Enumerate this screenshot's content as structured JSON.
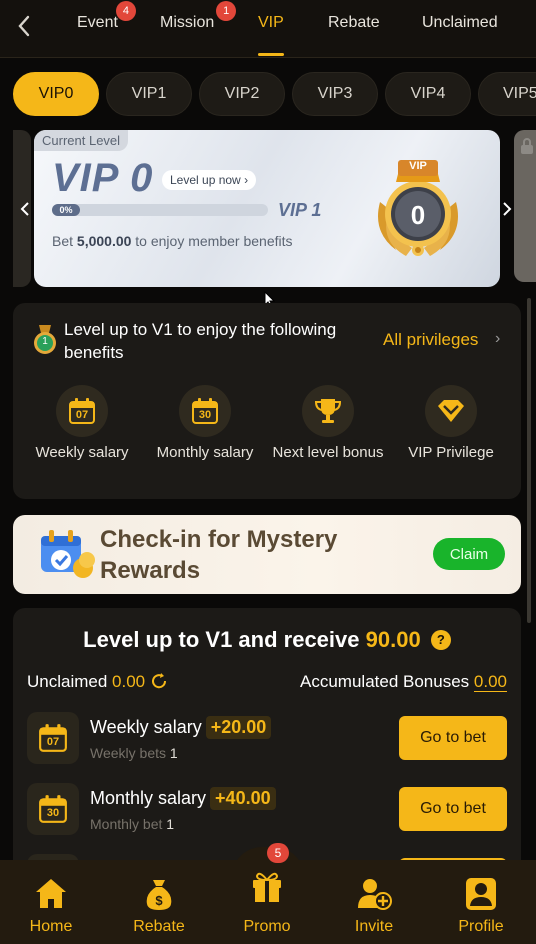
{
  "nav": {
    "tabs": [
      {
        "label": "Event",
        "badge": "4"
      },
      {
        "label": "Mission",
        "badge": "1"
      },
      {
        "label": "VIP",
        "badge": ""
      },
      {
        "label": "Rebate",
        "badge": ""
      },
      {
        "label": "Unclaimed",
        "badge": ""
      }
    ],
    "active_tab": "VIP"
  },
  "vip_pills": [
    "VIP0",
    "VIP1",
    "VIP2",
    "VIP3",
    "VIP4",
    "VIP5"
  ],
  "level_card": {
    "current_label": "Current Level",
    "vip_level": "VIP 0",
    "level_up_button": "Level up now",
    "progress_text": "0%",
    "progress_fraction": 0,
    "next_level": "VIP 1",
    "bet_prefix": "Bet",
    "bet_amount": "5,000.00",
    "bet_suffix": "to enjoy member benefits",
    "medal_number": "0",
    "medal_ribbon": "VIP"
  },
  "benefits": {
    "badge_number": "1",
    "heading": "Level up to V1 to enjoy the following benefits",
    "all_privileges": "All privileges",
    "items": [
      {
        "label": "Weekly salary",
        "icon": "calendar-icon",
        "icon_text": "07"
      },
      {
        "label": "Monthly salary",
        "icon": "calendar-icon",
        "icon_text": "30"
      },
      {
        "label": "Next level bonus",
        "icon": "trophy-icon",
        "icon_text": ""
      },
      {
        "label": "VIP Privilege",
        "icon": "diamond-icon",
        "icon_text": ""
      }
    ]
  },
  "checkin": {
    "text": "Check-in for Mystery Rewards",
    "claim": "Claim"
  },
  "levelup": {
    "title_prefix": "Level up to V1 and receive",
    "title_amount": "90.00",
    "help": "?",
    "unclaimed_label": "Unclaimed",
    "unclaimed_value": "0.00",
    "accumulated_label": "Accumulated Bonuses",
    "accumulated_value": "0.00",
    "tasks": [
      {
        "name": "Weekly salary",
        "bonus": "+20.00",
        "sub_label": "Weekly bets",
        "sub_value": "1",
        "button": "Go to bet",
        "icon_text": "07"
      },
      {
        "name": "Monthly salary",
        "bonus": "+40.00",
        "sub_label": "Monthly bet",
        "sub_value": "1",
        "button": "Go to bet",
        "icon_text": "30"
      }
    ]
  },
  "bottom_nav": {
    "items": [
      {
        "label": "Home",
        "icon": "home-icon"
      },
      {
        "label": "Rebate",
        "icon": "money-bag-icon"
      },
      {
        "label": "Promo",
        "icon": "gift-icon"
      },
      {
        "label": "Invite",
        "icon": "add-user-icon"
      },
      {
        "label": "Profile",
        "icon": "profile-icon"
      }
    ],
    "promo_badge": "5"
  },
  "colors": {
    "accent": "#f5b718",
    "background": "#0a0908",
    "panel": "#1c1a17",
    "claim_green": "#19b42b",
    "badge_red": "#e2473a"
  }
}
